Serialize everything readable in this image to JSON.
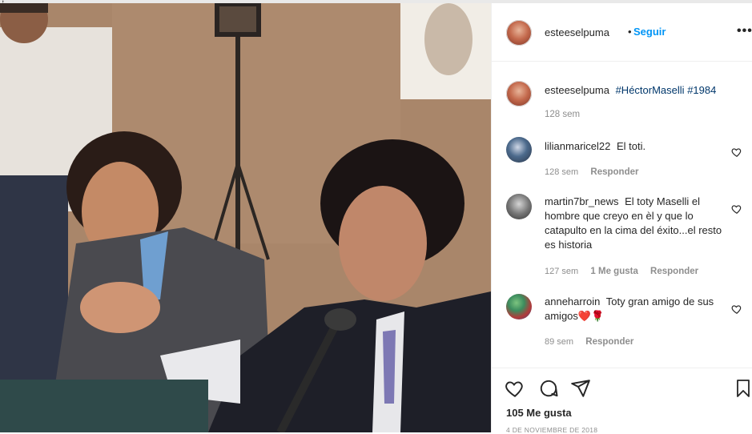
{
  "post": {
    "author": "esteeselpuma",
    "follow_label": "Seguir",
    "dot": "•",
    "more_label": "•••",
    "caption": {
      "username": "esteeselpuma",
      "hashtag1": "#HéctorMaselli",
      "hashtag2": "#1984",
      "time": "128 sem"
    },
    "comments": [
      {
        "username": "lilianmaricel22",
        "text": "El toti.",
        "time": "128 sem",
        "likes": "",
        "reply": "Responder"
      },
      {
        "username": "martin7br_news",
        "text": "El toty Maselli el hombre que creyo en èl y que lo catapulto en la cima del éxito...el resto es historia",
        "time": "127 sem",
        "likes": "1 Me gusta",
        "reply": "Responder"
      },
      {
        "username": "anneharroin",
        "text": "Toty gran amigo de sus amigos❤️🌹",
        "time": "89 sem",
        "likes": "",
        "reply": "Responder"
      }
    ],
    "likes_text": "105 Me gusta",
    "date_text": "4 DE NOVIEMBRE DE 2018"
  },
  "icons": {
    "like": "heart-icon",
    "comment": "comment-icon",
    "share": "share-icon",
    "save": "bookmark-icon",
    "options": "more-options-icon"
  },
  "colors": {
    "accent": "#0095f6",
    "hashtag": "#00376b",
    "muted": "#8e8e8e",
    "text": "#262626"
  }
}
